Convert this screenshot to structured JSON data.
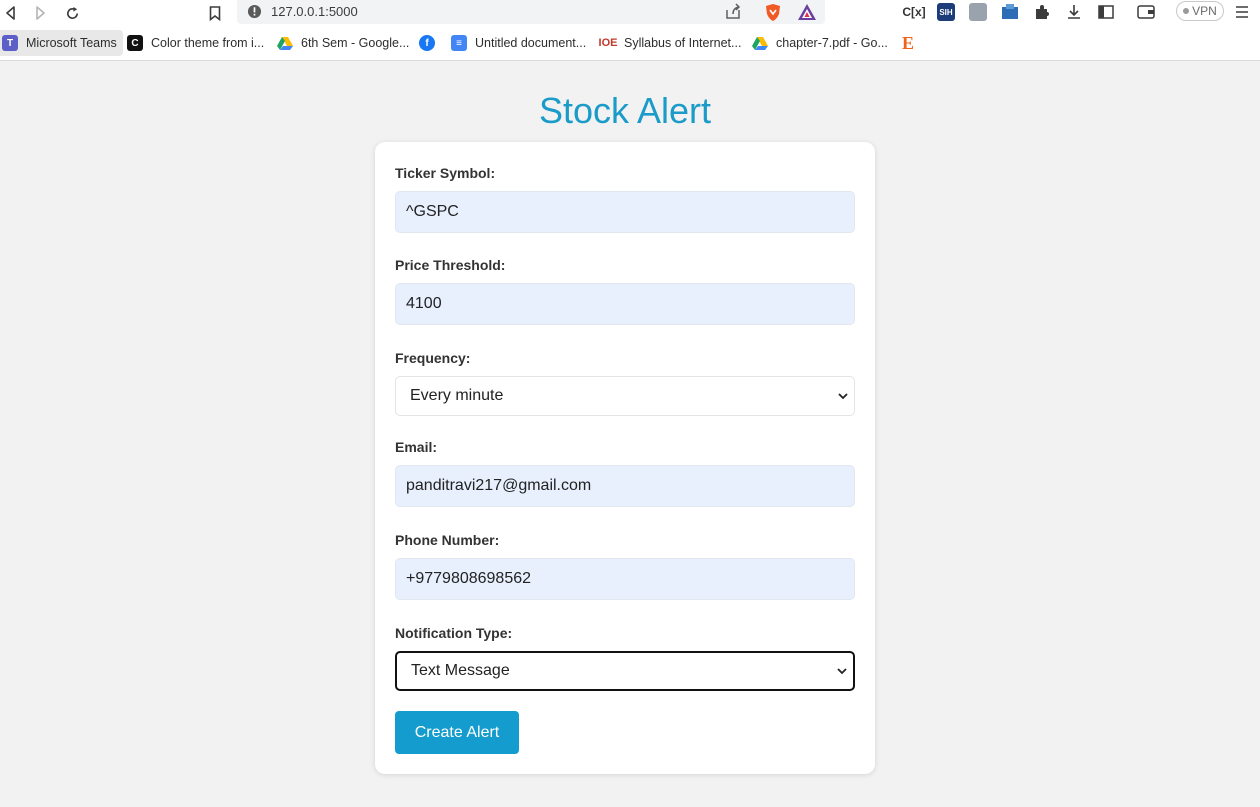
{
  "browser": {
    "url": "127.0.0.1:5000",
    "vpn_label": "VPN",
    "bookmarks": [
      {
        "label": "Microsoft Teams",
        "icon": "teams-icon",
        "color": "#5b5fc7"
      },
      {
        "label": "Color theme from i...",
        "icon": "color-theme-icon",
        "color": "#111111"
      },
      {
        "label": "6th Sem - Google...",
        "icon": "google-drive-icon",
        "color": "#1fa463"
      },
      {
        "label": "",
        "icon": "facebook-icon",
        "color": "#1877f2"
      },
      {
        "label": "Untitled document...",
        "icon": "google-docs-icon",
        "color": "#4285f4"
      },
      {
        "label": "Syllabus of Internet...",
        "icon": "ioe-icon",
        "color": "#c0392b"
      },
      {
        "label": "chapter-7.pdf - Go...",
        "icon": "google-drive-icon",
        "color": "#1fa463"
      },
      {
        "label": "",
        "icon": "etsy-icon",
        "color": "#f1641e"
      }
    ]
  },
  "page": {
    "title": "Stock Alert",
    "accent_color": "#1a9bc8",
    "form": {
      "ticker_label": "Ticker Symbol:",
      "ticker_value": "^GSPC",
      "threshold_label": "Price Threshold:",
      "threshold_value": "4100",
      "frequency_label": "Frequency:",
      "frequency_value": "Every minute",
      "email_label": "Email:",
      "email_value": "panditravi217@gmail.com",
      "phone_label": "Phone Number:",
      "phone_value": "+9779808698562",
      "notification_label": "Notification Type:",
      "notification_value": "Text Message",
      "submit_label": "Create Alert"
    }
  }
}
